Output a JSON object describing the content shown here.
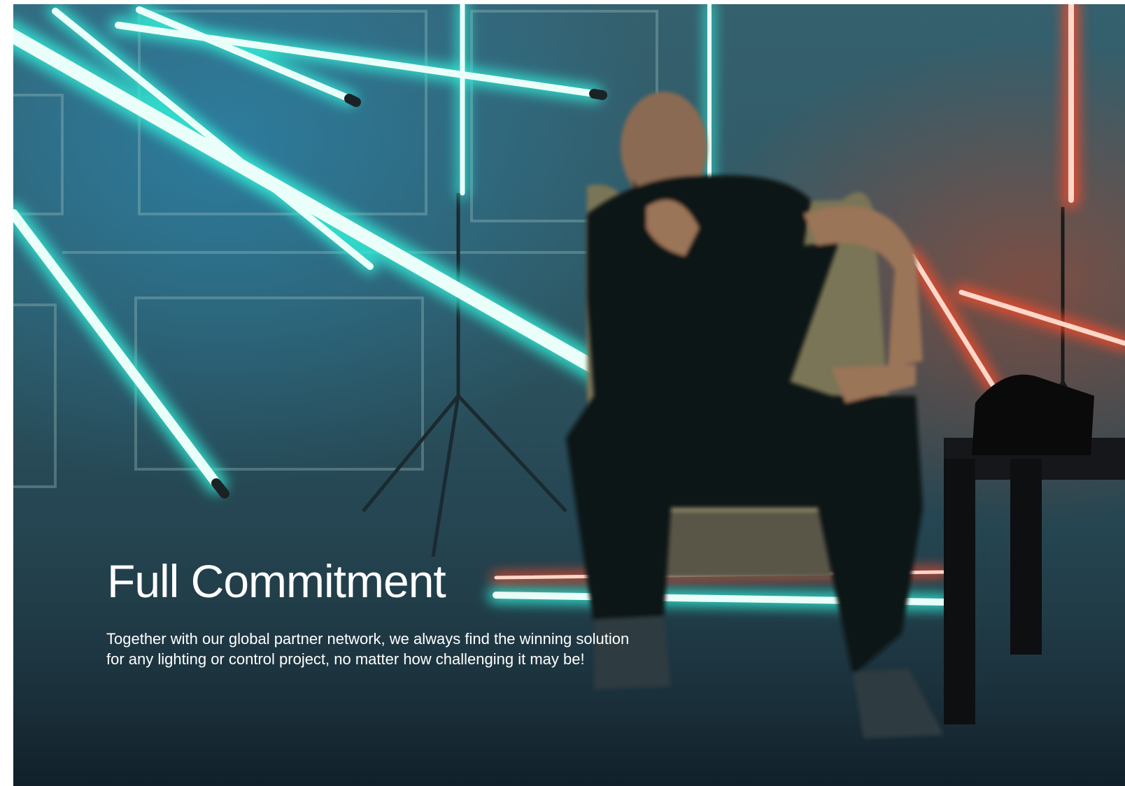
{
  "hero": {
    "headline": "Full Commitment",
    "body_line_1": "Together with our global partner network, we always find the winning solution",
    "body_line_2": "for any lighting or control project, no matter how challenging it may be!"
  },
  "colors": {
    "accent_cyan": "#8ff5e6",
    "accent_red": "#ff6a45",
    "text": "#ffffff"
  }
}
